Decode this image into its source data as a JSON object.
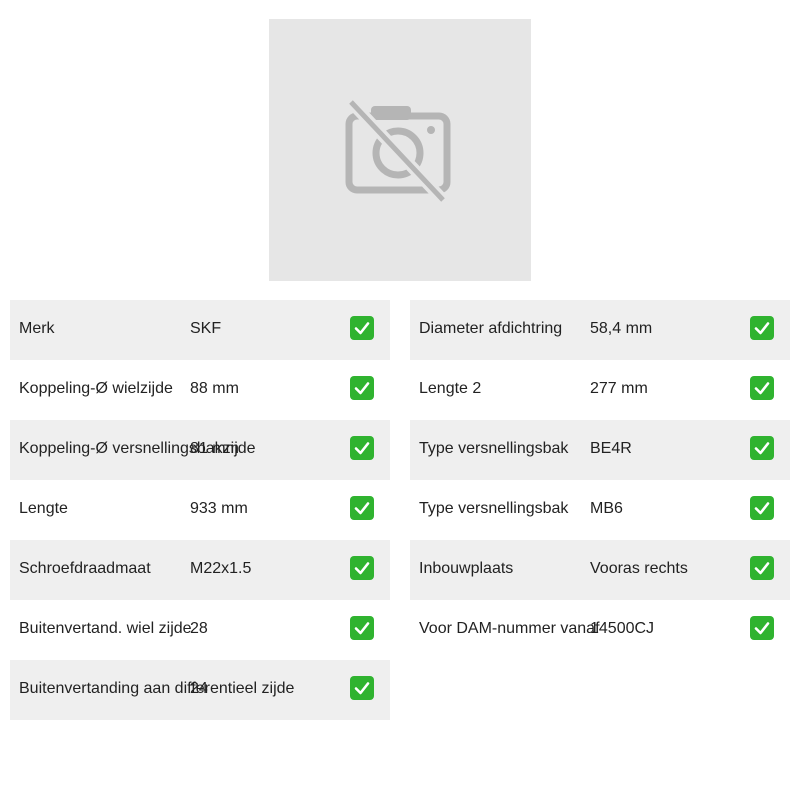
{
  "image": {
    "icon": "camera-off-icon"
  },
  "specs_left": [
    {
      "label": "Merk",
      "value": "SKF",
      "icon": "check-mark-icon"
    },
    {
      "label": "Koppeling-Ø wielzijde",
      "value": "88 mm",
      "icon": "check-mark-icon"
    },
    {
      "label": "Koppeling-Ø versnellingsbakzijde",
      "value": "81 mm",
      "icon": "check-mark-icon"
    },
    {
      "label": "Lengte",
      "value": "933 mm",
      "icon": "check-mark-icon"
    },
    {
      "label": "Schroefdraadmaat",
      "value": "M22x1.5",
      "icon": "check-mark-icon"
    },
    {
      "label": "Buitenvertand. wiel zijde",
      "value": "28",
      "icon": "check-mark-icon"
    },
    {
      "label": "Buitenvertanding aan differentieel zijde",
      "value": "24",
      "icon": "check-mark-icon"
    }
  ],
  "specs_right": [
    {
      "label": "Diameter afdichtring",
      "value": "58,4 mm",
      "icon": "check-mark-icon"
    },
    {
      "label": "Lengte 2",
      "value": "277 mm",
      "icon": "check-mark-icon"
    },
    {
      "label": "Type versnellingsbak",
      "value": "BE4R",
      "icon": "check-mark-icon"
    },
    {
      "label": "Type versnellingsbak",
      "value": "MB6",
      "icon": "check-mark-icon"
    },
    {
      "label": "Inbouwplaats",
      "value": "Vooras rechts",
      "icon": "check-mark-icon"
    },
    {
      "label": "Voor DAM-nummer vanaf",
      "value": "14500CJ",
      "icon": "check-mark-icon"
    }
  ],
  "colors": {
    "row_shade": "#efefef",
    "image_placeholder": "#e6e6e6",
    "check_green": "#2fb32f",
    "icon_gray": "#b5b5b5"
  }
}
